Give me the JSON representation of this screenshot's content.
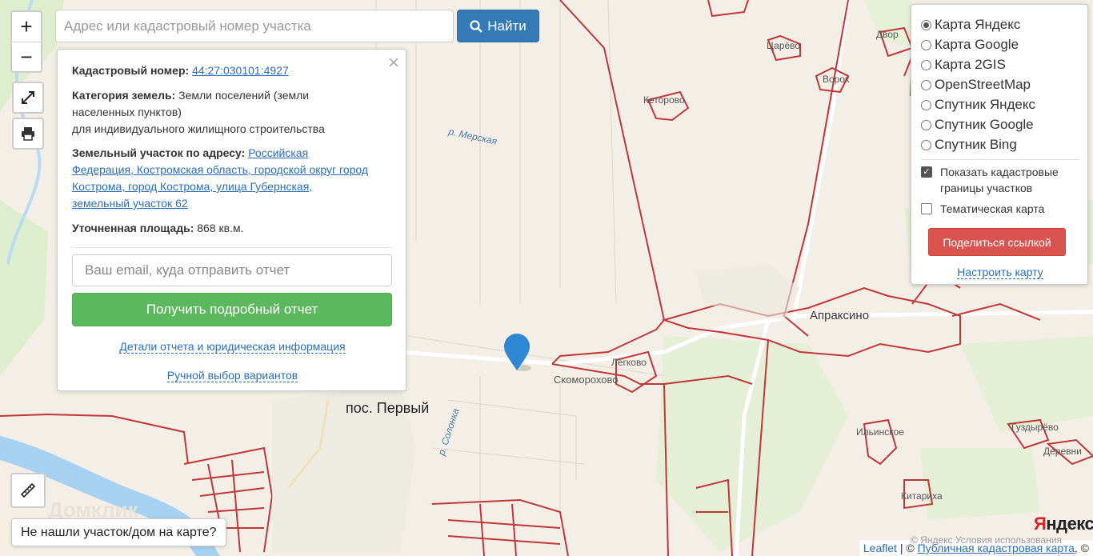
{
  "search": {
    "placeholder": "Адрес или кадастровый номер участка",
    "button_label": "Найти"
  },
  "zoom": {
    "in": "+",
    "out": "−"
  },
  "popup": {
    "close": "×",
    "cadastral_label": "Кадастровый номер:",
    "cadastral_value": "44:27:030101:4927",
    "category_label": "Категория земель:",
    "category_value_1": "Земли поселений (земли",
    "category_value_2": "населенных пунктов)",
    "category_value_3": "для индивидуального жилищного строительства",
    "address_label": "Земельный участок по адресу:",
    "address_line_1": "Российская",
    "address_line_2": "Федерация, Костромская область, городской округ город",
    "address_line_3": "Кострома, город Кострома, улица Губернская,",
    "address_line_4": "земельный участок 62",
    "area_label": "Уточненная площадь:",
    "area_value": "868 кв.м.",
    "email_placeholder": "Ваш email, куда отправить отчет",
    "report_button": "Получить подробный отчет",
    "details_link": "Детали отчета и юридическая информация",
    "manual_link": "Ручной выбор вариантов"
  },
  "layers": {
    "options": [
      {
        "label": "Карта Яндекс",
        "selected": true
      },
      {
        "label": "Карта Google",
        "selected": false
      },
      {
        "label": "Карта 2GIS",
        "selected": false
      },
      {
        "label": "OpenStreetMap",
        "selected": false
      },
      {
        "label": "Спутник Яндекс",
        "selected": false
      },
      {
        "label": "Спутник Google",
        "selected": false
      },
      {
        "label": "Спутник Bing",
        "selected": false
      }
    ],
    "cadastral_borders_1": "Показать кадастровые",
    "cadastral_borders_2": "границы участков",
    "cadastral_borders_checked": true,
    "thematic": "Тематическая карта",
    "thematic_checked": false,
    "share_button": "Поделиться ссылкой",
    "setup_link": "Настроить карту"
  },
  "not_found_button": "Не нашли участок/дом на карте?",
  "map_labels": {
    "pos_perviy": "пос. Первый",
    "merskaya": "р. Мерская",
    "solonka": "р. Солонка",
    "ketorovo": "Кеторово",
    "tsaryovo": "Царёво",
    "vorok": "Ворок",
    "dvor": "Двор",
    "apraksino": "Апраксино",
    "legkovo": "Легково",
    "skomorokhovo": "Скоморохово",
    "ilyinskoe": "Ильинское",
    "guzitsyno": "Гуздырёво",
    "derevni": "Деревни",
    "kitariha": "Китариха"
  },
  "watermark": "Домклик",
  "yandex_logo_red": "Я",
  "yandex_logo_rest": "ндекс",
  "attribution": {
    "leaflet": "Leaflet",
    "sep": " | © ",
    "pkk": "Публичная кадастровая карта",
    "tail": ", ©",
    "yandex_terms": "© Яндекс Условия использования"
  },
  "colors": {
    "parcel_border": "#c0363a",
    "primary_button": "#337ab7",
    "report_button": "#5cb85c",
    "share_button": "#d9534f",
    "map_marker": "#2f86d2"
  }
}
